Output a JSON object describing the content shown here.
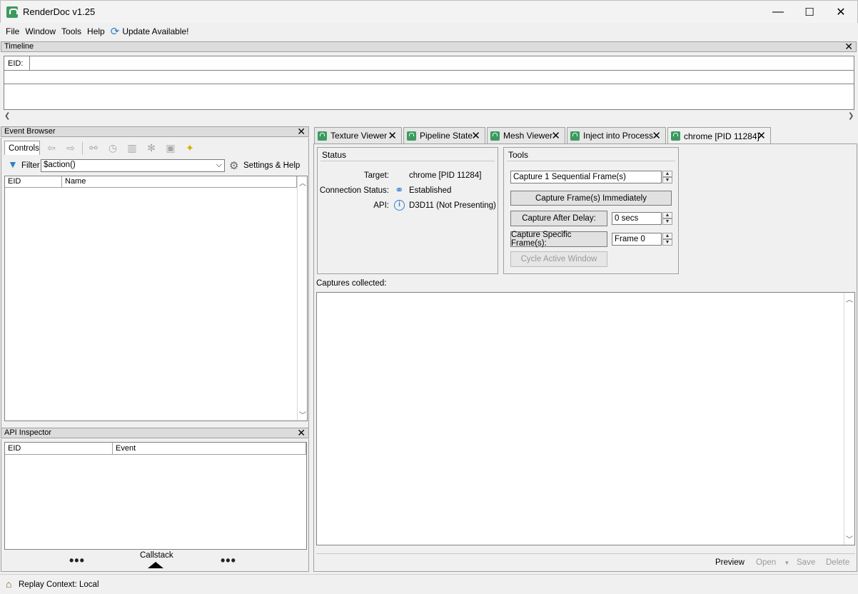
{
  "window": {
    "title": "RenderDoc v1.25",
    "minimize": "—",
    "maximize": "☐",
    "close": "✕"
  },
  "menu": {
    "file": "File",
    "window": "Window",
    "tools": "Tools",
    "help": "Help",
    "update": "Update Available!"
  },
  "timeline": {
    "title": "Timeline",
    "eid_label": "EID:"
  },
  "event_browser": {
    "title": "Event Browser",
    "controls_label": "Controls",
    "filter_label": "Filter",
    "filter_value": "$action()",
    "settings_label": "Settings & Help",
    "columns": [
      "EID",
      "Name"
    ]
  },
  "api_inspector": {
    "title": "API Inspector",
    "columns": [
      "EID",
      "Event"
    ],
    "callstack_label": "Callstack"
  },
  "tabs": [
    "Texture Viewer",
    "Pipeline State",
    "Mesh Viewer",
    "Inject into Process",
    "chrome [PID 11284]"
  ],
  "status": {
    "title": "Status",
    "target_label": "Target:",
    "target_value": "chrome [PID 11284]",
    "connection_label": "Connection Status:",
    "connection_value": "Established",
    "api_label": "API:",
    "api_value": "D3D11 (Not Presenting)"
  },
  "tools": {
    "title": "Tools",
    "capture_sequential": "Capture 1 Sequential Frame(s)",
    "capture_immediately": "Capture Frame(s) Immediately",
    "capture_after_delay": "Capture After Delay:",
    "delay_value": "0 secs",
    "capture_specific": "Capture Specific Frame(s):",
    "frame_value": "Frame 0",
    "cycle_window": "Cycle Active Window"
  },
  "captures": {
    "label": "Captures collected:",
    "preview": "Preview",
    "open": "Open",
    "save": "Save",
    "delete": "Delete"
  },
  "statusbar": {
    "replay_context": "Replay Context: Local"
  },
  "colors": {
    "accent": "#3c9a5f",
    "info": "#2f7fd0"
  }
}
